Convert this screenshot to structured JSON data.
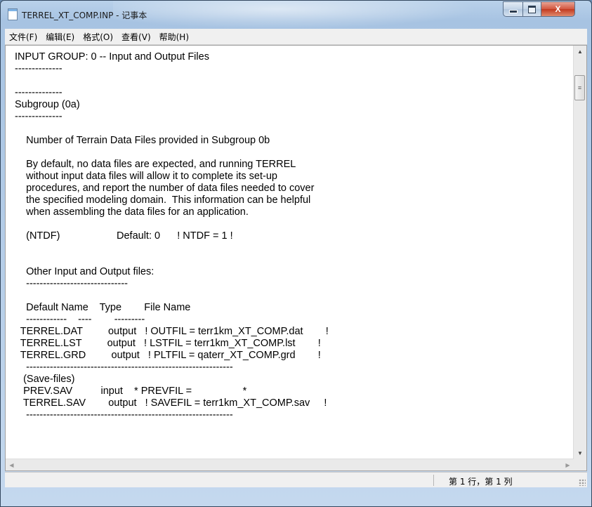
{
  "window": {
    "title": "TERREL_XT_COMP.INP - 记事本",
    "controls": {
      "minimize": "minimize",
      "maximize": "maximize",
      "close": "X"
    }
  },
  "menu": [
    "文件(F)",
    "编辑(E)",
    "格式(O)",
    "查看(V)",
    "帮助(H)"
  ],
  "content_lines": [
    "INPUT GROUP: 0 -- Input and Output Files",
    "--------------",
    "",
    "--------------",
    "Subgroup (0a)",
    "--------------",
    "",
    "    Number of Terrain Data Files provided in Subgroup 0b",
    "",
    "    By default, no data files are expected, and running TERREL",
    "    without input data files will allow it to complete its set-up",
    "    procedures, and report the number of data files needed to cover",
    "    the specified modeling domain.  This information can be helpful",
    "    when assembling the data files for an application.",
    "",
    "    (NTDF)                    Default: 0      ! NTDF = 1 !",
    "",
    "",
    "    Other Input and Output files:",
    "    ------------------------------",
    "",
    "    Default Name    Type        File Name",
    "    ------------    ----        ---------",
    "  TERREL.DAT         output   ! OUTFIL = terr1km_XT_COMP.dat        !",
    "  TERREL.LST         output   ! LSTFIL = terr1km_XT_COMP.lst        !",
    "  TERREL.GRD         output   ! PLTFIL = qaterr_XT_COMP.grd        !",
    "    -------------------------------------------------------------",
    "   (Save-files)",
    "   PREV.SAV          input    * PREVFIL =                  *",
    "   TERREL.SAV        output   ! SAVEFIL = terr1km_XT_COMP.sav     !",
    "    -------------------------------------------------------------"
  ],
  "scrollbars": {
    "up": "▲",
    "down": "▼",
    "left": "◀",
    "right": "▶",
    "thumb_grip": "≡"
  },
  "status": {
    "position": "第 1 行，第 1 列"
  }
}
